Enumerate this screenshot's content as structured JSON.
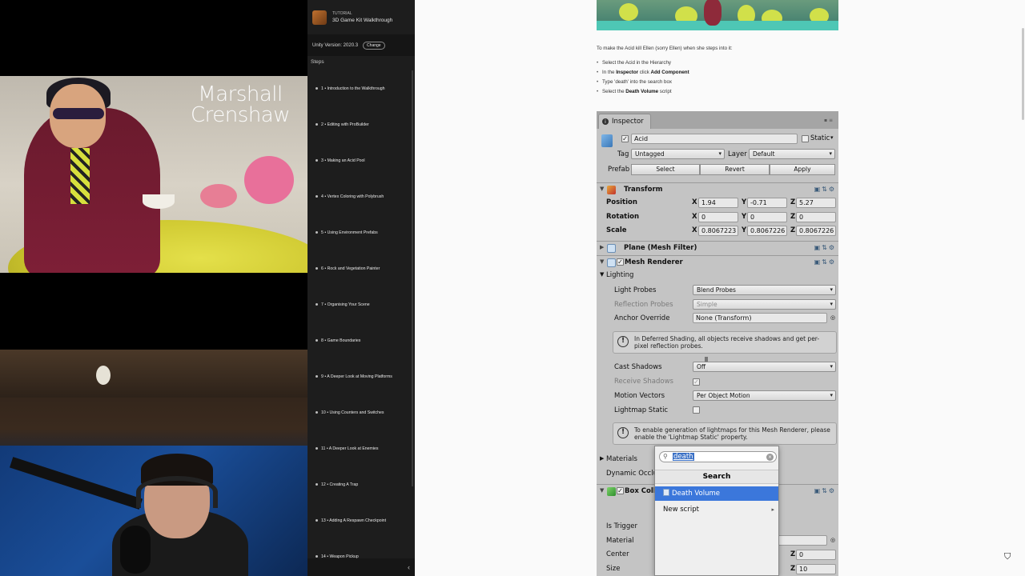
{
  "stream": {
    "album": {
      "line1": "Marshall",
      "line2": "Crenshaw"
    }
  },
  "sidebar": {
    "header_small": "TUTORIAL",
    "header_title": "3D Game Kit Walkthrough",
    "version_text": "Unity Version: 2020.3",
    "change_label": "Change",
    "steps_label": "Steps",
    "steps": [
      "1 • Introduction to the Walkthrough",
      "2 • Editing with ProBuilder",
      "3 • Making an Acid Pool",
      "4 • Vertex Coloring with Polybrush",
      "5 • Using Environment Prefabs",
      "6 • Rock and Vegetation Painter",
      "7 • Organising Your Scene",
      "8 • Game Boundaries",
      "9 • A Deeper Look at Moving Platforms",
      "10 • Using Counters and Switches",
      "11 • A Deeper Look at Enemies",
      "12 • Creating A Trap",
      "13 • Adding A Respawn Checkpoint",
      "14 • Weapon Pickup"
    ],
    "collapse_icon": "‹"
  },
  "article": {
    "intro": "To make the Acid kill Ellen (sorry Ellen) when she steps into it:",
    "bullets": [
      {
        "pre": "Select the Acid in the Hierarchy",
        "b1": "",
        "mid": "",
        "b2": ""
      },
      {
        "pre": "In the ",
        "b1": "Inspector",
        "mid": " click ",
        "b2": "Add Component"
      },
      {
        "pre": "Type 'death' into the search box",
        "b1": "",
        "mid": "",
        "b2": ""
      },
      {
        "pre": "Select the ",
        "b1": "Death Volume",
        "mid": " script",
        "b2": ""
      }
    ]
  },
  "inspector": {
    "tab_label": "Inspector",
    "object_name": "Acid",
    "static_label": "Static",
    "tag_label": "Tag",
    "tag_value": "Untagged",
    "layer_label": "Layer",
    "layer_value": "Default",
    "prefab_label": "Prefab",
    "prefab_buttons": [
      "Select",
      "Revert",
      "Apply"
    ],
    "transform": {
      "title": "Transform",
      "position_label": "Position",
      "rotation_label": "Rotation",
      "scale_label": "Scale",
      "axis": [
        "X",
        "Y",
        "Z"
      ],
      "position": [
        "1.94",
        "-0.71",
        "5.27"
      ],
      "rotation": [
        "0",
        "0",
        "0"
      ],
      "scale": [
        "0.8067223",
        "0.8067226",
        "0.8067226"
      ]
    },
    "mesh_filter_title": "Plane (Mesh Filter)",
    "mesh_renderer": {
      "title": "Mesh Renderer",
      "lighting_label": "Lighting",
      "light_probes_label": "Light Probes",
      "light_probes_value": "Blend Probes",
      "reflection_probes_label": "Reflection Probes",
      "reflection_probes_value": "Simple",
      "anchor_override_label": "Anchor Override",
      "anchor_override_value": "None (Transform)",
      "deferred_help": "In Deferred Shading, all objects receive shadows and get per-pixel reflection probes.",
      "cast_shadows_label": "Cast Shadows",
      "cast_shadows_value": "Off",
      "receive_shadows_label": "Receive Shadows",
      "motion_vectors_label": "Motion Vectors",
      "motion_vectors_value": "Per Object Motion",
      "lightmap_static_label": "Lightmap Static",
      "lightmap_help": "To enable generation of lightmaps for this Mesh Renderer, please enable the 'Lightmap Static' property.",
      "materials_label": "Materials",
      "dynamic_occlusion_label": "Dynamic Occlu"
    },
    "box_collider": {
      "title": "Box Coll",
      "is_trigger_label": "Is Trigger",
      "material_label": "Material",
      "center_label": "Center",
      "size_label": "Size",
      "center_z": "0",
      "size_z": "10"
    }
  },
  "popup": {
    "search_value": "death",
    "header": "Search",
    "items": [
      "Death Volume",
      "New script"
    ]
  },
  "icons": {
    "shield": "shield-icon"
  }
}
